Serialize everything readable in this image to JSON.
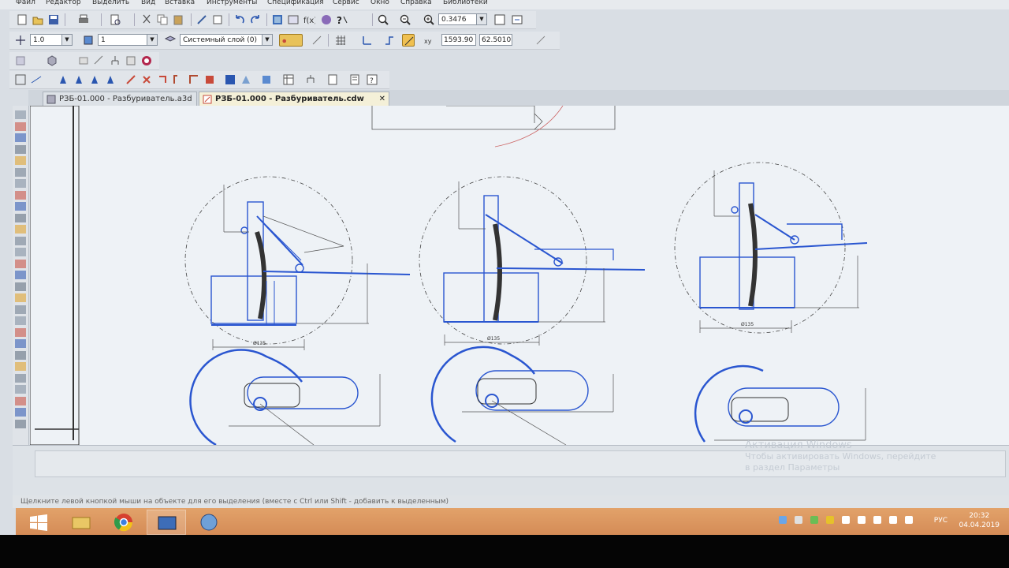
{
  "menu": [
    "Файл",
    "Редактор",
    "Выделить",
    "Вид",
    "Вставка",
    "Инструменты",
    "Спецификация",
    "Сервис",
    "Окно",
    "Справка",
    "Библиотеки"
  ],
  "toolbar": {
    "zoom_value": "0.3476",
    "line_scale": "1.0",
    "line_style": "1",
    "layer": "Системный слой (0)",
    "coord_x": "1593.90",
    "coord_y": "62.5010"
  },
  "tabs": [
    {
      "label": "РЗБ-01.000 - Разбуриватель.a3d",
      "active": false
    },
    {
      "label": "РЗБ-01.000 - Разбуриватель.cdw",
      "active": true
    }
  ],
  "status": {
    "hint": "Щелкните левой кнопкой мыши на объекте для его выделения (вместе с Ctrl или Shift - добавить к выделенным)"
  },
  "watermark": {
    "title": "Активация Windows",
    "line1": "Чтобы активировать Windows, перейдите",
    "line2": "в раздел Параметры"
  },
  "taskbar": {
    "language": "РУС",
    "time": "20:32",
    "date": "04.04.2019"
  },
  "icons": {
    "taskbar": [
      "windows-start-icon",
      "file-explorer-icon",
      "chrome-icon",
      "kompas-icon",
      "network-app-icon"
    ]
  },
  "drawing": {
    "view_labels": [
      "Ø135",
      "Ø135",
      "Ø135"
    ]
  }
}
